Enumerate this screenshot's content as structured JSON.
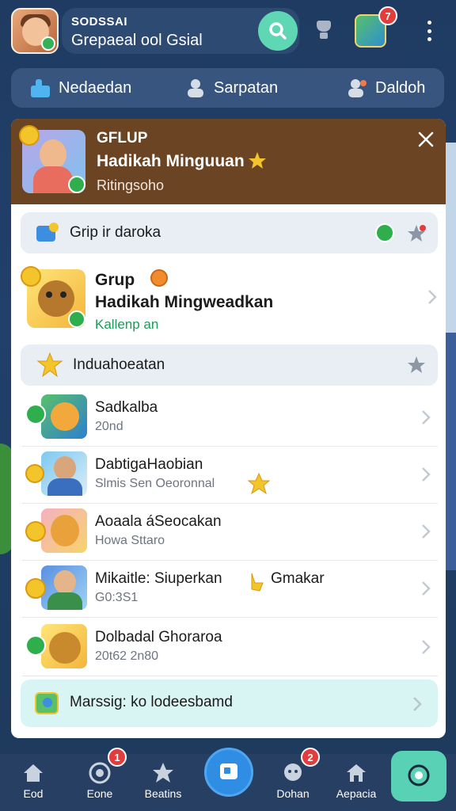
{
  "topbar": {
    "username_line1": "SODSSAI",
    "username_line2": "Grepaeal ool Gsial",
    "map_notification": "7"
  },
  "tabs": [
    {
      "label": "Nedaedan"
    },
    {
      "label": "Sarpatan"
    },
    {
      "label": "Daldoh"
    }
  ],
  "card": {
    "header": {
      "line1": "GFLUP",
      "line2": "Hadikah Minguuan",
      "line3": "Ritingsoho"
    },
    "group_section": {
      "label": "Grip ir daroka"
    },
    "featured": {
      "line1": "Grup",
      "line2": "Hadikah Mingweadkan",
      "line3": "Kallenp an"
    },
    "favorites_section": {
      "label": "Induahoeatan"
    },
    "rows": [
      {
        "title": "Sadkalba",
        "subtitle": "20nd"
      },
      {
        "title": "DabtigaHaobian",
        "subtitle": "Slmis Sen Oeoronnal"
      },
      {
        "title": "Aoaala áSeocakan",
        "subtitle": "Howa Sttaro"
      },
      {
        "title": "Mikaitle: Siuperkan",
        "title_suffix": "Gmakar",
        "subtitle": "G0:3S1"
      },
      {
        "title": "Dolbadal Ghoraroa",
        "subtitle": "20t62 2n80"
      }
    ],
    "footer_pill": {
      "label": "Marssig: ko lodeesbamd"
    }
  },
  "bottomnav": [
    {
      "label": "Eod"
    },
    {
      "label": "Eone",
      "badge": "1"
    },
    {
      "label": "Beatins"
    },
    {
      "label": "Dohan",
      "badge": "2"
    },
    {
      "label": "Aepacia"
    }
  ],
  "colors": {
    "background": "#21406a",
    "header_brown": "#6b4423",
    "accent_teal": "#5fd6b4",
    "fab_blue": "#2f8de3",
    "notification_red": "#e33c3c"
  }
}
